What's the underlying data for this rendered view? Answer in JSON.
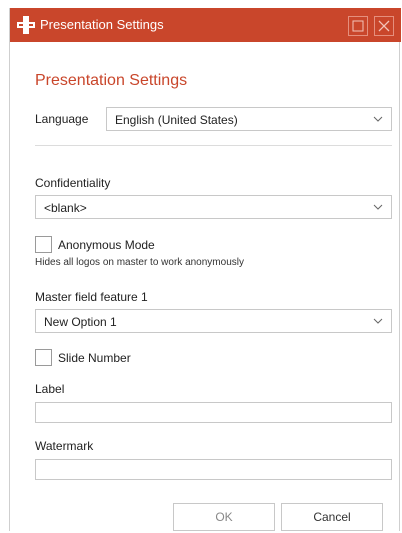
{
  "window": {
    "title": "Presentation Settings",
    "accent_color": "#c9462b"
  },
  "form": {
    "heading": "Presentation Settings",
    "language": {
      "label": "Language",
      "value": "English (United States)"
    },
    "confidentiality": {
      "label": "Confidentiality",
      "value": "<blank>"
    },
    "anonymous_mode": {
      "label": "Anonymous Mode",
      "hint": "Hides all logos on master to work anonymously",
      "checked": false
    },
    "master_field": {
      "label": "Master field feature 1",
      "value": "New Option 1"
    },
    "slide_number": {
      "label": "Slide Number",
      "checked": false
    },
    "label_field": {
      "label": "Label",
      "value": ""
    },
    "watermark_field": {
      "label": "Watermark",
      "value": ""
    }
  },
  "buttons": {
    "ok": "OK",
    "cancel": "Cancel"
  },
  "icons": {
    "app": "presentation-logo-icon",
    "maximize": "maximize-icon",
    "close": "close-icon",
    "dropdown": "chevron-down-icon"
  }
}
